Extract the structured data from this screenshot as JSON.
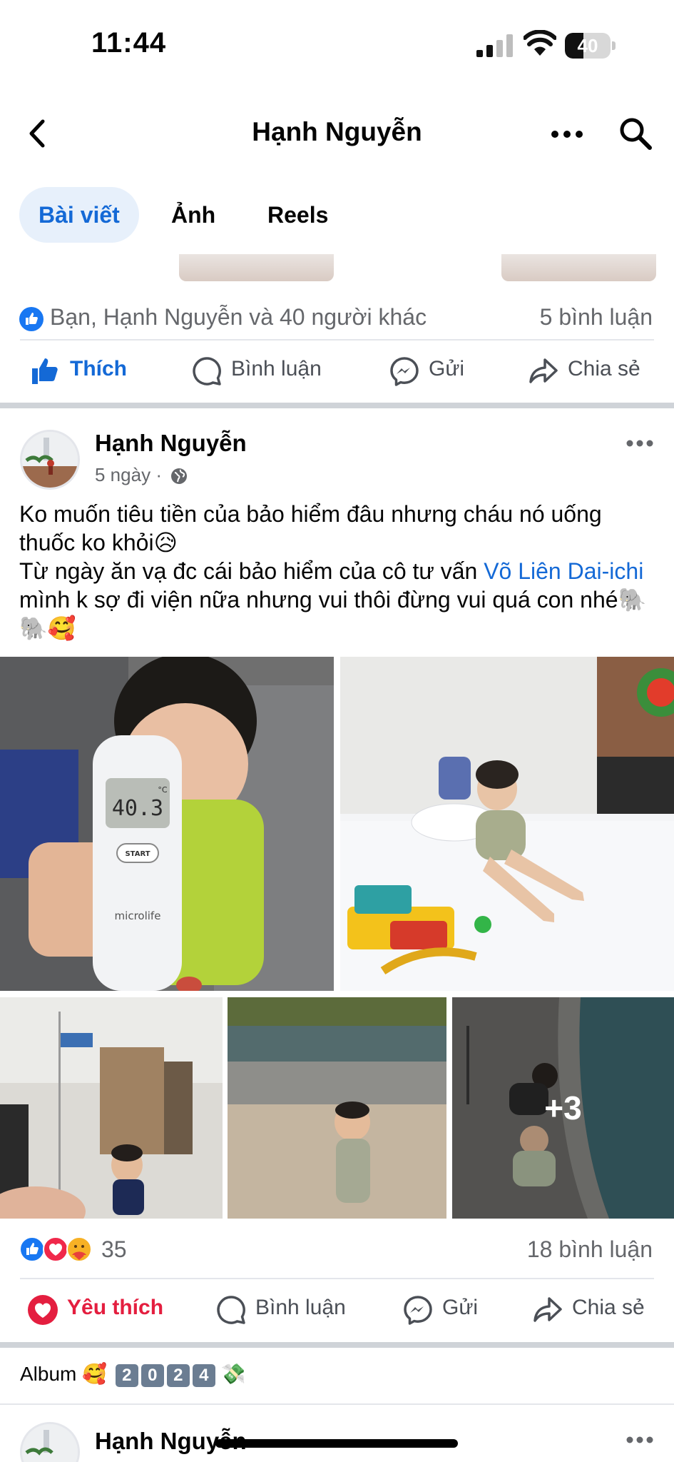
{
  "status_bar": {
    "time": "11:44",
    "battery": "40",
    "battery_level": 0.4
  },
  "header": {
    "title": "Hạnh Nguyễn"
  },
  "tabs": [
    {
      "label": "Bài viết",
      "active": true
    },
    {
      "label": "Ảnh",
      "active": false
    },
    {
      "label": "Reels",
      "active": false
    }
  ],
  "prev_post": {
    "reactions_text": "Bạn, Hạnh Nguyễn và 40 người khác",
    "comments": "5 bình luận",
    "actions": {
      "like": "Thích",
      "comment": "Bình luận",
      "send": "Gửi",
      "share": "Chia sẻ"
    }
  },
  "post": {
    "author": "Hạnh Nguyễn",
    "time": "5 ngày",
    "privacy_icon": "globe-icon",
    "text_line1": "Ko muốn tiêu tiền của bảo hiểm đâu nhưng cháu nó uống thuốc ko khỏi😥",
    "text_line2_before": "Từ ngày ăn vạ đc cái bảo hiểm của cô tư vấn ",
    "mention": "Võ Liên Dai-ichi",
    "text_line2_after": " mình k sợ đi viện nữa nhưng vui thôi đừng vui quá con nhé🐘🐘🥰",
    "thermometer": {
      "reading": "40.3",
      "unit": "°C",
      "button": "START",
      "brand": "microlife"
    },
    "more_photos": "+3",
    "reaction_count": "35",
    "comments": "18 bình luận",
    "actions": {
      "like": "Yêu thích",
      "comment": "Bình luận",
      "send": "Gửi",
      "share": "Chia sẻ"
    }
  },
  "album": {
    "label": "Album 🥰",
    "digits": [
      "2",
      "0",
      "2",
      "4"
    ],
    "emoji": "💸"
  },
  "next_post": {
    "author": "Hạnh Nguyễn"
  },
  "colors": {
    "accent": "#1469d6",
    "love": "#e41e3f",
    "secondary_text": "#65676b",
    "tab_active_bg": "#e7f0fb"
  }
}
